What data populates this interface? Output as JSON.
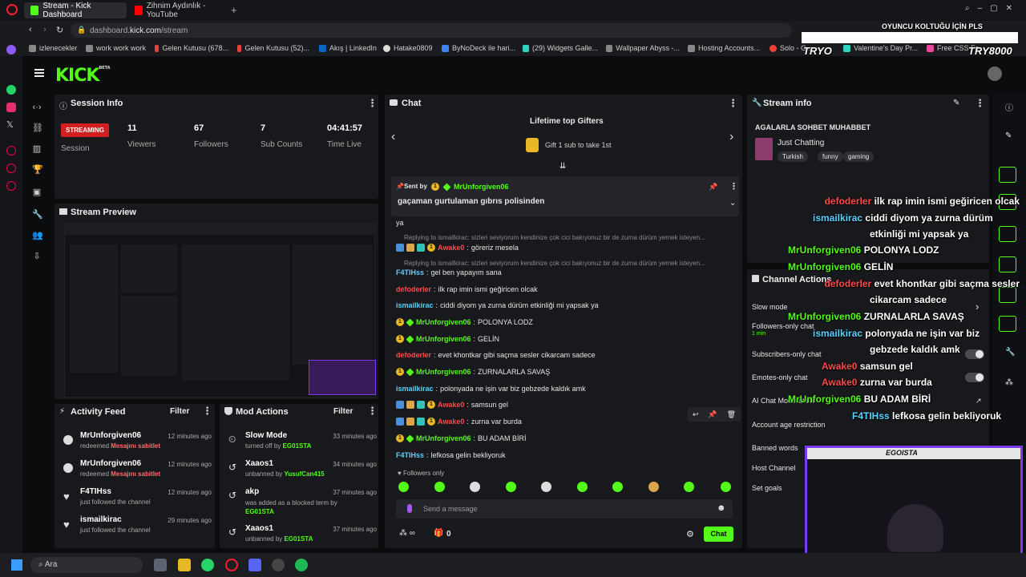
{
  "browser": {
    "tabs": [
      {
        "label": "Stream - Kick Dashboard",
        "active": true
      },
      {
        "label": "Zihnim Aydınlık - YouTube",
        "active": false
      }
    ],
    "url_prefix": "dashboard.",
    "url_host": "kick.com",
    "url_path": "/stream",
    "bookmarks": [
      "izlenecekler",
      "work work work",
      "Gelen Kutusu (678...",
      "Gelen Kutusu (52)...",
      "Akış | LinkedIn",
      "Hatake0809",
      "ByNoDeck ile hari...",
      "(29) Widgets Galle...",
      "Wallpaper Abyss -...",
      "Hosting Accounts...",
      "Solo - G...",
      "Valentine's Day Pr...",
      "Free CSS Fo..."
    ]
  },
  "brand": {
    "logo": "KICK",
    "beta": "BETA",
    "accent": "#53fc18"
  },
  "session": {
    "title": "Session Info",
    "badge": "STREAMING",
    "session_label": "Session",
    "stats": [
      {
        "value": "11",
        "label": "Viewers"
      },
      {
        "value": "67",
        "label": "Followers"
      },
      {
        "value": "7",
        "label": "Sub Counts"
      },
      {
        "value": "04:41:57",
        "label": "Time Live"
      }
    ]
  },
  "preview": {
    "title": "Stream Preview"
  },
  "activity": {
    "title": "Activity Feed",
    "filter": "Filter",
    "items": [
      {
        "name": "MrUnforgiven06",
        "pre": "redeemed ",
        "hl": "Mesajını sabitlet",
        "time": "12 minutes ago"
      },
      {
        "name": "MrUnforgiven06",
        "pre": "redeemed ",
        "hl": "Mesajını sabitlet",
        "time": "12 minutes ago"
      },
      {
        "name": "F4TIHss",
        "pre": "just followed the channel",
        "hl": "",
        "time": "12 minutes ago"
      },
      {
        "name": "ismailkirac",
        "pre": "just followed the channel",
        "hl": "",
        "time": "29 minutes ago"
      }
    ]
  },
  "modactions": {
    "title": "Mod Actions",
    "filter": "Filter",
    "items": [
      {
        "name": "Slow Mode",
        "pre": "turned off by ",
        "hl": "EG01STA",
        "time": "33 minutes ago"
      },
      {
        "name": "Xaaos1",
        "pre": "unbanned by ",
        "hl": "YusufCan415",
        "time": "34 minutes ago"
      },
      {
        "name": "akp",
        "pre": "was added as a blocked term by ",
        "hl": "EG01STA",
        "time": "37 minutes ago"
      },
      {
        "name": "Xaaos1",
        "pre": "unbanned by ",
        "hl": "EG01STA",
        "time": "37 minutes ago"
      }
    ]
  },
  "chat": {
    "title": "Chat",
    "gifters_title": "Lifetime top Gifters",
    "gifters_sub": "Gift 1 sub to take 1st",
    "pinned_by": "Sent by",
    "pinned_user": "MrUnforgiven06",
    "pinned_msg": "gaçaman gurtulaman gıbrıs polisinden",
    "lines": [
      {
        "user": "",
        "msg": "ya",
        "color": "#e6e6e6"
      },
      {
        "reply": "Replying to ismailkirac: sizleri seviyorum kendinize çok cici bakıyonuz bir de zurna dürüm yemek isteyen..."
      },
      {
        "user": "Awake0",
        "msg": "göreriz mesela",
        "color": "#ff4a4a",
        "badges": [
          "b3",
          "b4",
          "b5",
          "b1"
        ]
      },
      {
        "reply": "Replying to ismailkirac: sizleri seviyorum kendinize çok cici bakıyonuz bir de zurna dürüm yemek isteyen..."
      },
      {
        "user": "F4TIHss",
        "msg": "gel ben yapayım sana",
        "color": "#5ad2ff"
      },
      {
        "user": "defoderler",
        "msg": "ilk rap imin ismi geğiricen olcak",
        "color": "#ff4a4a"
      },
      {
        "user": "ismailkirac",
        "msg": "ciddi diyom ya zurna dürüm etkinliği mi yapsak ya",
        "color": "#5ad2ff"
      },
      {
        "user": "MrUnforgiven06",
        "msg": "POLONYA LODZ",
        "color": "#53fc18",
        "badges": [
          "b1",
          "b2"
        ]
      },
      {
        "user": "MrUnforgiven06",
        "msg": "GELİN",
        "color": "#53fc18",
        "badges": [
          "b1",
          "b2"
        ]
      },
      {
        "user": "defoderler",
        "msg": "evet khontkar gibi saçma sesler cikarcam sadece",
        "color": "#ff4a4a"
      },
      {
        "user": "MrUnforgiven06",
        "msg": "ZURNALARLA SAVAŞ",
        "color": "#53fc18",
        "badges": [
          "b1",
          "b2"
        ]
      },
      {
        "user": "ismailkirac",
        "msg": "polonyada ne işin var biz gebzede kaldık amk",
        "color": "#5ad2ff"
      },
      {
        "user": "Awake0",
        "msg": "samsun gel",
        "color": "#ff4a4a",
        "badges": [
          "b3",
          "b4",
          "b5",
          "b1"
        ]
      },
      {
        "user": "Awake0",
        "msg": "zurna var burda",
        "color": "#ff4a4a",
        "badges": [
          "b3",
          "b4",
          "b5",
          "b1"
        ]
      },
      {
        "user": "MrUnforgiven06",
        "msg": "BU ADAM BİRİ",
        "color": "#53fc18",
        "badges": [
          "b1",
          "b2"
        ]
      },
      {
        "user": "F4TIHss",
        "msg": "lefkosa gelin bekliyoruk",
        "color": "#5ad2ff"
      }
    ],
    "followers_only": "Followers only",
    "placeholder": "Send a message",
    "send": "Chat",
    "points": "0"
  },
  "streaminfo": {
    "title": "Stream info",
    "stream_title": "AGALARLA SOHBET MUHABBET",
    "category": "Just Chatting",
    "tags": [
      "Turkish",
      "funny",
      "gaming"
    ]
  },
  "channel_actions": {
    "title": "Channel Actions",
    "items": [
      "Slow mode",
      "Followers-only chat",
      "Subscribers-only chat",
      "Emotes-only chat",
      "AI Chat Moderation",
      "Account age restriction",
      "Banned words",
      "Host Channel",
      "Set goals"
    ],
    "followers_sub": "1 min"
  },
  "overlay": {
    "banner": "OYUNCU KOLTUĞU İÇİN PLS",
    "left_tag": "TRYO",
    "right_tag": "TRY8000",
    "cam_name": "EGOISTA",
    "lines": [
      {
        "user": "defoderler",
        "msg": "ilk rap imin ismi geğiricen olcak",
        "color": "#ff4a4a"
      },
      {
        "user": "ismailkirac",
        "msg": "ciddi diyom ya zurna dürüm",
        "color": "#5ad2ff"
      },
      {
        "user": "",
        "msg": "etkinliği mi yapsak ya",
        "color": "#fff"
      },
      {
        "user": "MrUnforgiven06",
        "msg": "POLONYA LODZ",
        "color": "#53fc18"
      },
      {
        "user": "MrUnforgiven06",
        "msg": "GELİN",
        "color": "#53fc18"
      },
      {
        "user": "defoderler",
        "msg": "evet khontkar gibi saçma sesler",
        "color": "#ff4a4a"
      },
      {
        "user": "",
        "msg": "cikarcam sadece",
        "color": "#fff"
      },
      {
        "user": "MrUnforgiven06",
        "msg": "ZURNALARLA SAVAŞ",
        "color": "#53fc18"
      },
      {
        "user": "ismailkirac",
        "msg": "polonyada ne işin var biz",
        "color": "#5ad2ff"
      },
      {
        "user": "",
        "msg": "gebzede kaldık amk",
        "color": "#fff"
      },
      {
        "user": "Awake0",
        "msg": "samsun gel",
        "color": "#ff4a4a"
      },
      {
        "user": "Awake0",
        "msg": "zurna var burda",
        "color": "#ff4a4a"
      },
      {
        "user": "MrUnforgiven06",
        "msg": "BU ADAM BİRİ",
        "color": "#53fc18"
      },
      {
        "user": "F4TIHss",
        "msg": "lefkosa gelin bekliyoruk",
        "color": "#5ad2ff"
      }
    ]
  },
  "taskbar": {
    "search": "Ara"
  }
}
